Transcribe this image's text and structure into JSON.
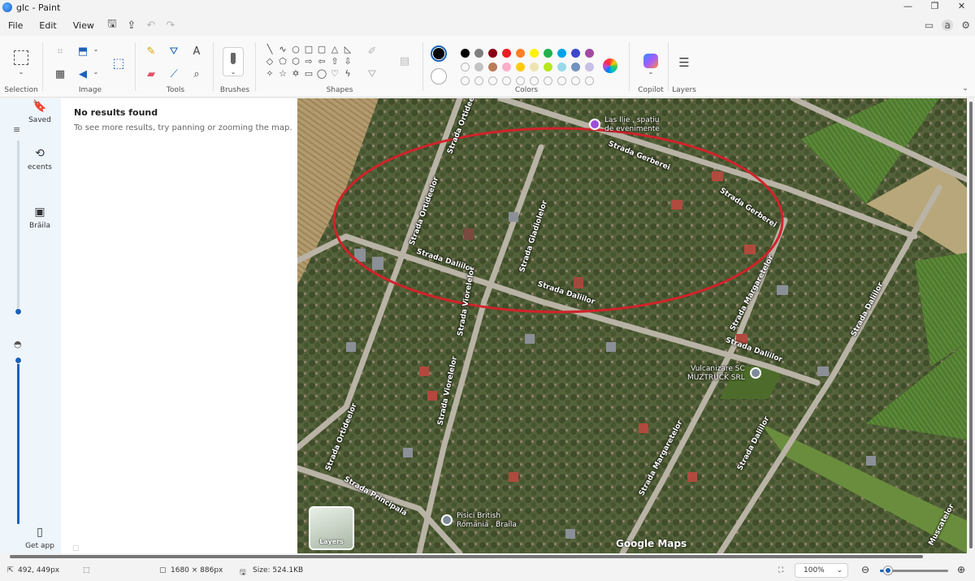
{
  "window": {
    "title": "glc - Paint",
    "controls": [
      "—",
      "❐",
      "✕"
    ]
  },
  "menu": {
    "items": [
      "File",
      "Edit",
      "View"
    ],
    "icons": [
      "save-icon",
      "share-icon",
      "undo-icon",
      "redo-icon"
    ]
  },
  "ribbon": {
    "groups": {
      "selection": "Selection",
      "image": "Image",
      "tools": "Tools",
      "brushes": "Brushes",
      "shapes": "Shapes",
      "colors": "Colors",
      "copilot": "Copilot",
      "layers": "Layers"
    },
    "primary_color": "#000000",
    "secondary_color": "#ffffff",
    "palette": [
      "#000000",
      "#7f7f7f",
      "#880015",
      "#ed1c24",
      "#ff7f27",
      "#fff200",
      "#22b14c",
      "#00a2e8",
      "#3f48cc",
      "#a349a4",
      "",
      "#c3c3c3",
      "#b97a57",
      "#ffaec9",
      "#ffc90e",
      "#efe4b0",
      "#b5e61d",
      "#99d9ea",
      "#7092be",
      "#c8bfe7",
      "",
      "",
      "",
      "",
      "",
      "",
      "",
      "",
      "",
      ""
    ]
  },
  "side_strip": {
    "saved": "Saved",
    "recents": "ecents",
    "location": "Brăila",
    "get_app": "Get app"
  },
  "results": {
    "title": "No results found",
    "subtitle": "To see more results, try panning or zooming the map."
  },
  "map": {
    "roads": [
      {
        "label": "Strada Gerberei"
      },
      {
        "label": "Strada Gerberei"
      },
      {
        "label": "Strada Ortideelor"
      },
      {
        "label": "Strada Ortideelor"
      },
      {
        "label": "Strada Daliilor"
      },
      {
        "label": "Strada Daliilor"
      },
      {
        "label": "Strada Daliilor"
      },
      {
        "label": "Strada Daliilor"
      },
      {
        "label": "Strada Daliilor"
      },
      {
        "label": "Strada Gladiolelor"
      },
      {
        "label": "Strada Viorelelor"
      },
      {
        "label": "Strada Viorelelor"
      },
      {
        "label": "Strada Margaretelor"
      },
      {
        "label": "Strada Margaretelor"
      },
      {
        "label": "Strada Principală"
      },
      {
        "label": "Strada Ortideelor"
      },
      {
        "label": "Muscatelor"
      }
    ],
    "pois": [
      {
        "name": "Las Ilie , spațiu de evenimente",
        "lines": [
          "Las Ilie , spațiu",
          "de evenimente"
        ]
      },
      {
        "name": "Vulcanizare SC MUZTRUCK SRL",
        "lines": [
          "Vulcanizare SC",
          "MUZTRUCK SRL"
        ]
      },
      {
        "name": "Pisici British Romania , Braila",
        "lines": [
          "Pisici British",
          "Romania , Braila"
        ]
      }
    ],
    "layers_label": "Layers",
    "attribution": "Google Maps"
  },
  "status": {
    "cursor": "492, 449px",
    "canvas_size": "1680 × 886px",
    "file_size": "Size: 524.1KB",
    "zoom": "100%"
  }
}
